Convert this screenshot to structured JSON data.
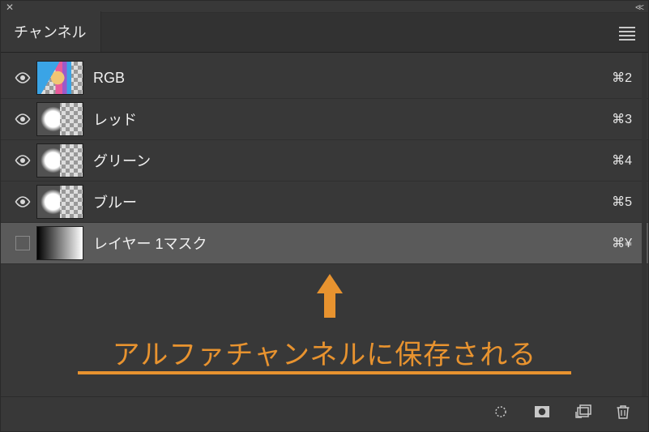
{
  "panel": {
    "tab_title": "チャンネル"
  },
  "channels": [
    {
      "name": "RGB",
      "shortcut": "⌘2",
      "thumb": "rgb",
      "visible": true,
      "selected": false
    },
    {
      "name": "レッド",
      "shortcut": "⌘3",
      "thumb": "gray",
      "visible": true,
      "selected": false
    },
    {
      "name": "グリーン",
      "shortcut": "⌘4",
      "thumb": "gray",
      "visible": true,
      "selected": false
    },
    {
      "name": "ブルー",
      "shortcut": "⌘5",
      "thumb": "gray",
      "visible": true,
      "selected": false
    },
    {
      "name": "レイヤー 1マスク",
      "shortcut": "⌘¥",
      "thumb": "gradient",
      "visible": false,
      "selected": true
    }
  ],
  "annotation": {
    "text": "アルファチャンネルに保存される"
  },
  "icons": {
    "close_panel": "close-icon",
    "collapse_panel": "collapse-icon",
    "panel_menu": "menu-icon",
    "selection_to_channel": "load-selection-icon",
    "mask_from_selection": "save-selection-mask-icon",
    "new_channel": "new-channel-icon",
    "delete_channel": "trash-icon",
    "eye": "eye-icon"
  },
  "colors": {
    "accent": "#e8932f",
    "panel_bg": "#383838",
    "selected_bg": "#5a5a5a"
  }
}
